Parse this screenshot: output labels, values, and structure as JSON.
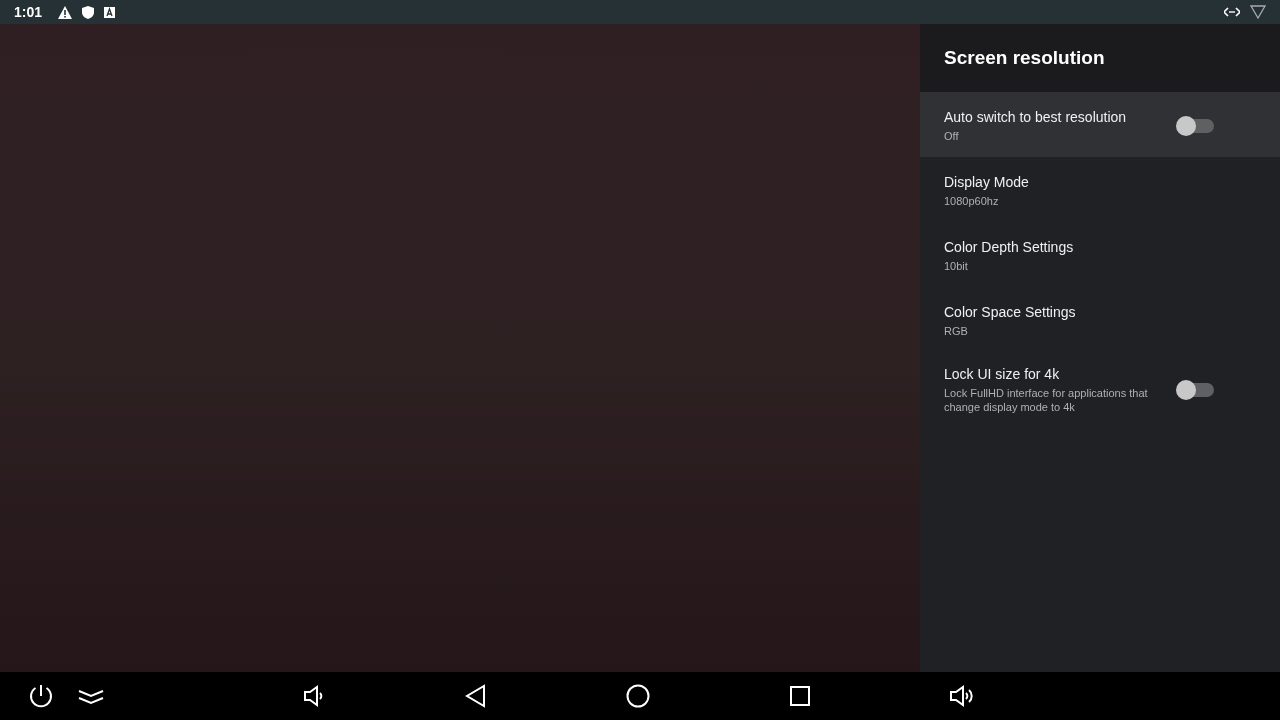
{
  "status_bar": {
    "time": "1:01"
  },
  "panel": {
    "title": "Screen resolution",
    "items": [
      {
        "kind": "switch",
        "title": "Auto switch to best resolution",
        "summary": "Off",
        "on": false,
        "selected": true
      },
      {
        "kind": "value",
        "title": "Display Mode",
        "summary": "1080p60hz",
        "selected": false
      },
      {
        "kind": "value",
        "title": "Color Depth Settings",
        "summary": "10bit",
        "selected": false
      },
      {
        "kind": "value",
        "title": "Color Space Settings",
        "summary": "RGB",
        "selected": false
      },
      {
        "kind": "switch",
        "title": "Lock UI size for 4k",
        "summary": "Lock FullHD interface for applications that change display mode to 4k",
        "on": false,
        "selected": false
      }
    ]
  }
}
